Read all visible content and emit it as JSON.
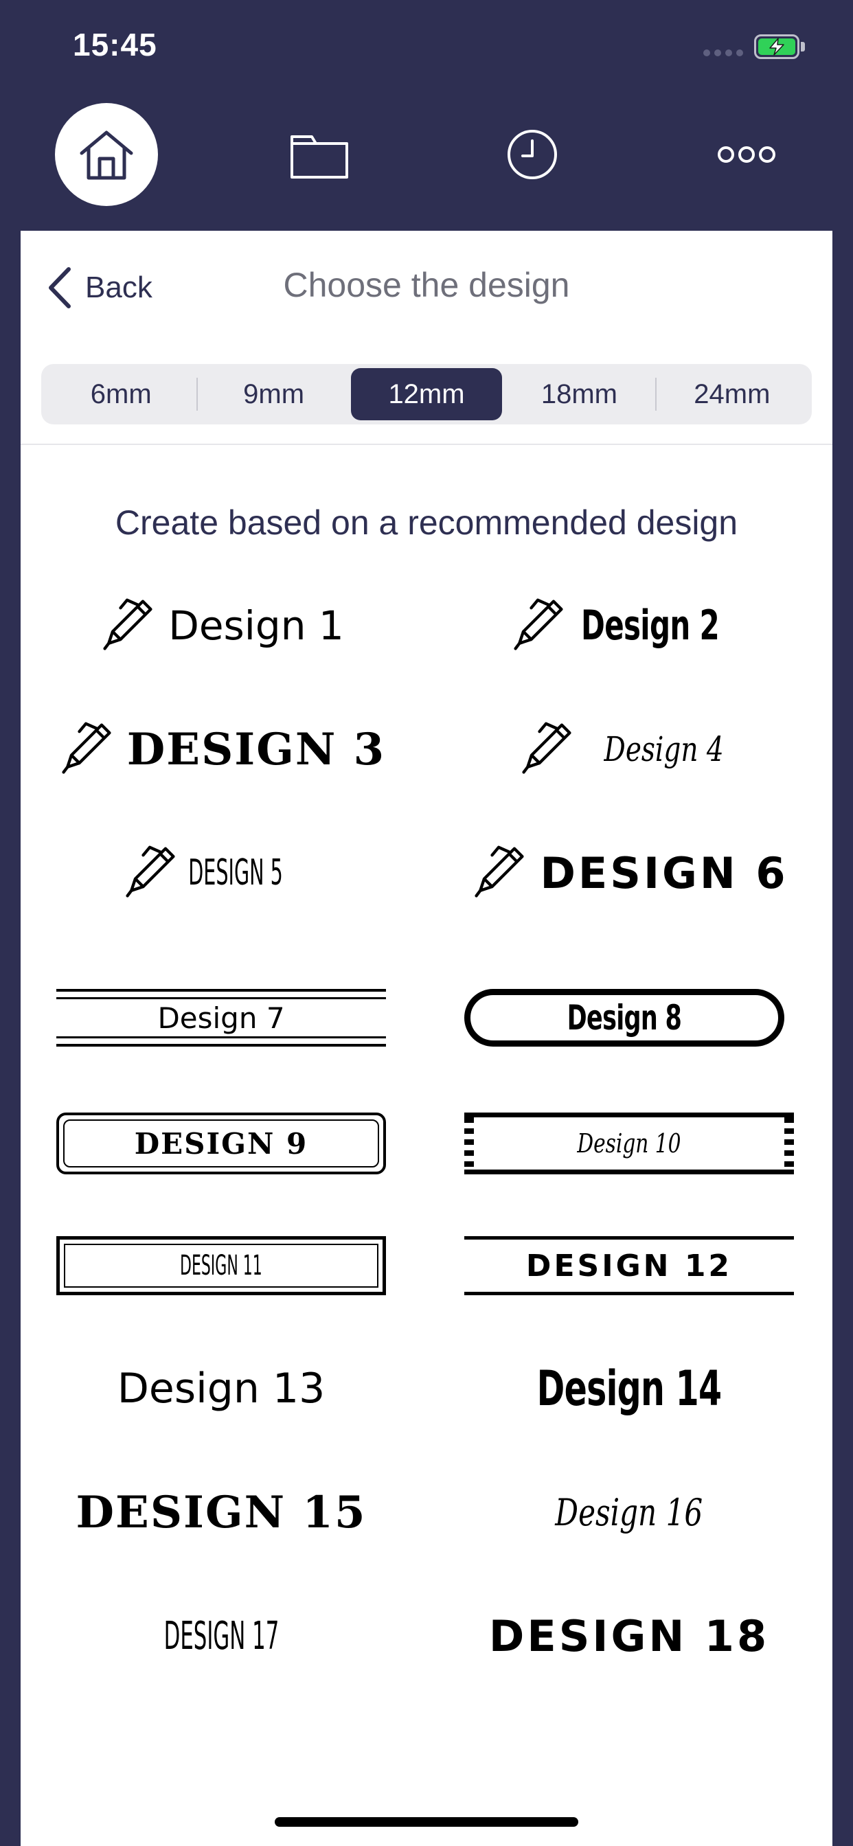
{
  "status_bar": {
    "time": "15:45",
    "battery_color": "#30d158"
  },
  "nav": {
    "items": [
      {
        "icon": "home-icon",
        "active": true
      },
      {
        "icon": "folder-icon",
        "active": false
      },
      {
        "icon": "clock-icon",
        "active": false
      },
      {
        "icon": "more-icon",
        "active": false
      }
    ]
  },
  "header": {
    "back_label": "Back",
    "title": "Choose the design"
  },
  "tape_sizes": {
    "options": [
      "6mm",
      "9mm",
      "12mm",
      "18mm",
      "24mm"
    ],
    "selected": "12mm"
  },
  "section": {
    "title": "Create based on a recommended design"
  },
  "designs": [
    {
      "label": "Design 1"
    },
    {
      "label": "Design 2"
    },
    {
      "label": "DESIGN 3"
    },
    {
      "label": "Design 4"
    },
    {
      "label": "DESIGN 5"
    },
    {
      "label": "DESIGN 6"
    },
    {
      "label": "Design 7"
    },
    {
      "label": "Design 8"
    },
    {
      "label": "DESIGN 9"
    },
    {
      "label": "Design 10"
    },
    {
      "label": "DESIGN 11"
    },
    {
      "label": "DESIGN 12"
    },
    {
      "label": "Design 13"
    },
    {
      "label": "Design 14"
    },
    {
      "label": "DESIGN 15"
    },
    {
      "label": "Design 16"
    },
    {
      "label": "DESIGN 17"
    },
    {
      "label": "DESIGN 18"
    }
  ],
  "colors": {
    "navy": "#2e2f52",
    "panel": "#ffffff",
    "segment_bg": "#ececef"
  }
}
